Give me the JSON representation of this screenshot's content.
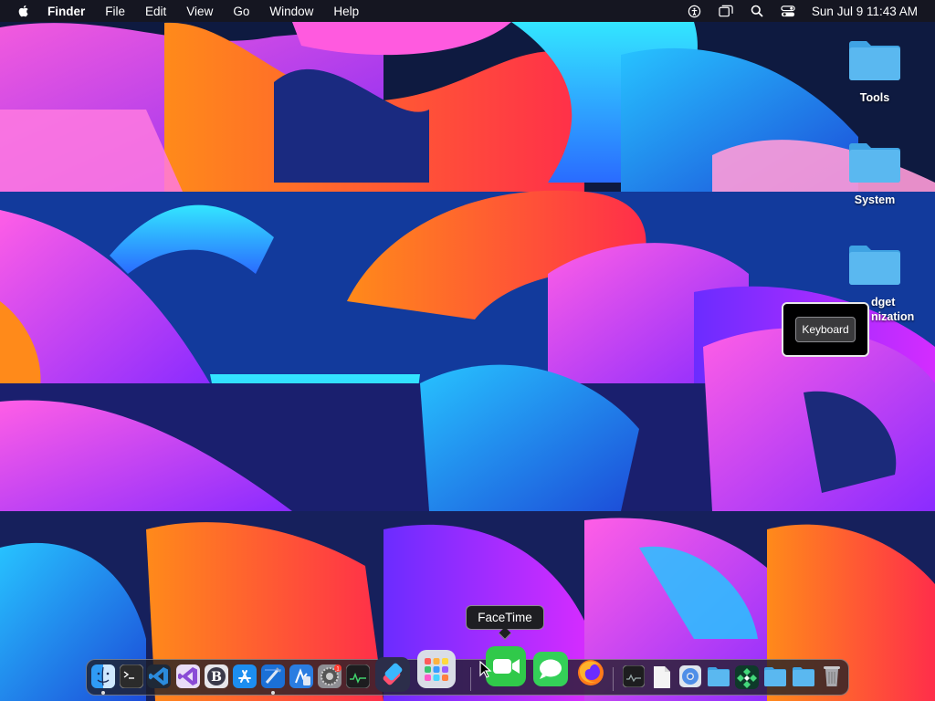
{
  "menubar": {
    "apple_icon": "apple-logo-icon",
    "app_name": "Finder",
    "items": [
      "File",
      "Edit",
      "View",
      "Go",
      "Window",
      "Help"
    ],
    "status_icons": [
      "accessibility-icon",
      "screen-mirroring-icon",
      "spotlight-search-icon",
      "control-center-icon"
    ],
    "clock": "Sun Jul 9  11:43 AM"
  },
  "desktop": {
    "items": [
      {
        "label": "Tools",
        "icon": "folder-icon"
      },
      {
        "label": "System",
        "icon": "folder-icon"
      },
      {
        "label_line1": "dget",
        "label_line2": "nization",
        "icon": "folder-icon"
      }
    ]
  },
  "keyboard_panel": {
    "button_label": "Keyboard"
  },
  "tooltip": {
    "text": "FaceTime"
  },
  "dock": {
    "apps": [
      "finder",
      "terminal",
      "visual-studio-code",
      "visual-studio",
      "bbedit",
      "app-store",
      "xcode",
      "simulator",
      "system-settings",
      "activity-monitor",
      "shortcuts",
      "launchpad",
      "facetime",
      "messages",
      "firefox",
      "console",
      "textedit-document",
      "chrome",
      "folder",
      "maps",
      "folder",
      "folder",
      "trash"
    ],
    "running": [
      "finder",
      "xcode"
    ],
    "system_settings_badge": "1"
  },
  "colors": {
    "menubar_bg": "#16161e",
    "folder_blue": "#5ab8f0",
    "facetime_green": "#30c94a",
    "messages_green": "#34d058"
  }
}
